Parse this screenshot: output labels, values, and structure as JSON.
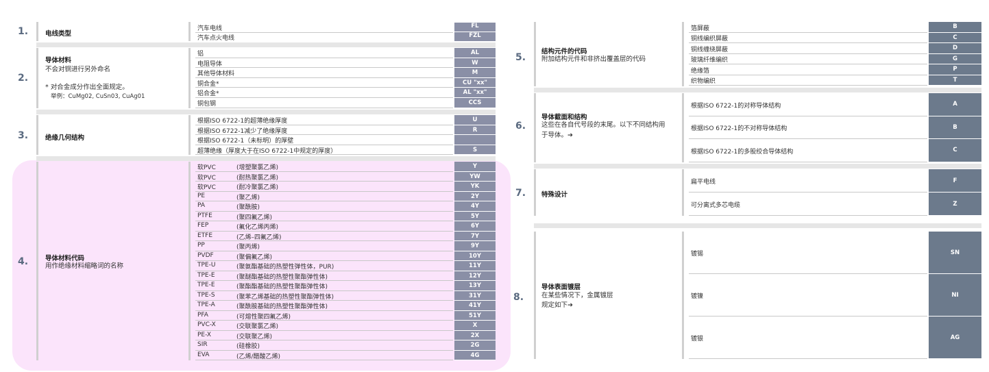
{
  "left": {
    "s1": {
      "num": "1.",
      "title": "电线类型",
      "rows": [
        {
          "label": "汽车电线",
          "code": "FL"
        },
        {
          "label": "汽车点火电线",
          "code": "FZL"
        }
      ]
    },
    "s2": {
      "num": "2.",
      "title": "导体材料",
      "sub": "不会对铜进行另外命名",
      "note1": "* 对合金成分作出全面规定。",
      "note2": "举例：CuMg02, CuSn03, CuAg01",
      "rows": [
        {
          "label": "铝",
          "code": "AL"
        },
        {
          "label": "电阻导体",
          "code": "W"
        },
        {
          "label": "其他导体材料",
          "code": "M"
        },
        {
          "label": "铜合金*",
          "code": "CU \"xx\""
        },
        {
          "label": "铝合金*",
          "code": "AL \"xx\""
        },
        {
          "label": "铜包钢",
          "code": "CCS"
        }
      ]
    },
    "s3": {
      "num": "3.",
      "title": "绝缘几何结构",
      "rows": [
        {
          "label": "根据ISO 6722-1的超薄绝缘厚度",
          "code": "U"
        },
        {
          "label": "根据ISO 6722-1减少了绝缘厚度",
          "code": "R"
        },
        {
          "label": "根据ISO 6722-1（未标明）的厚壁",
          "code": ""
        },
        {
          "label": "超薄绝缘（厚度大于在ISO 6722-1中规定的厚度）",
          "code": "S"
        }
      ]
    },
    "s4": {
      "num": "4.",
      "title": "导体材料代码",
      "sub": "用作绝缘材料缩略词的名称",
      "rows": [
        {
          "abbr": "软PVC",
          "label": "(增塑聚氯乙烯)",
          "code": "Y"
        },
        {
          "abbr": "软PVC",
          "label": "(耐热聚氯乙烯)",
          "code": "YW"
        },
        {
          "abbr": "软PVC",
          "label": "(耐冷聚氯乙烯)",
          "code": "YK"
        },
        {
          "abbr": "PE",
          "label": "(聚乙烯)",
          "code": "2Y"
        },
        {
          "abbr": "PA",
          "label": "(聚酰胺)",
          "code": "4Y"
        },
        {
          "abbr": "PTFE",
          "label": "(聚四氟乙烯)",
          "code": "5Y"
        },
        {
          "abbr": "FEP",
          "label": "(氟化乙烯丙烯)",
          "code": "6Y"
        },
        {
          "abbr": "ETFE",
          "label": "(乙烯–四氟乙烯)",
          "code": "7Y"
        },
        {
          "abbr": "PP",
          "label": "(聚丙烯)",
          "code": "9Y"
        },
        {
          "abbr": "PVDF",
          "label": "(聚偏氟乙烯)",
          "code": "10Y"
        },
        {
          "abbr": "TPE-U",
          "label": "(聚氨酯基础的热塑性弹性体，PUR)",
          "code": "11Y"
        },
        {
          "abbr": "TPE-E",
          "label": "(聚醚酯基础的热塑性聚酯弹性体)",
          "code": "12Y"
        },
        {
          "abbr": "TPE-E",
          "label": "(聚酯酯基础的热塑性聚酯弹性体)",
          "code": "13Y"
        },
        {
          "abbr": "TPE-S",
          "label": "(聚苯乙烯基础的热塑性聚酯弹性体)",
          "code": "31Y"
        },
        {
          "abbr": "TPE-A",
          "label": "(聚酰胺基础的热塑性聚酯弹性体)",
          "code": "41Y"
        },
        {
          "abbr": "PFA",
          "label": "(可熔性聚四氟乙烯)",
          "code": "51Y"
        },
        {
          "abbr": "PVC-X",
          "label": "(交联聚氯乙烯)",
          "code": "X"
        },
        {
          "abbr": "PE-X",
          "label": "(交联聚乙烯)",
          "code": "2X"
        },
        {
          "abbr": "SIR",
          "label": "(硅橡胶)",
          "code": "2G"
        },
        {
          "abbr": "EVA",
          "label": "(乙烯/醋酸乙烯)",
          "code": "4G"
        }
      ]
    }
  },
  "right": {
    "s5": {
      "num": "5.",
      "title": "结构元件的代码",
      "sub": "附加结构元件和非挤出覆盖层的代码",
      "rows": [
        {
          "label": "箔屏蔽",
          "code": "B"
        },
        {
          "label": "铜线编织屏蔽",
          "code": "C"
        },
        {
          "label": "铜线缠绕屏蔽",
          "code": "D"
        },
        {
          "label": "玻璃纤维编织",
          "code": "G"
        },
        {
          "label": "绝缘箔",
          "code": "P"
        },
        {
          "label": "织物编织",
          "code": "T"
        }
      ]
    },
    "s6": {
      "num": "6.",
      "title": "导体截面和结构",
      "sub1": "这些在各自代号段的末尾。以下不同结构用",
      "sub2": "于导体。➔",
      "rows": [
        {
          "label": "根据ISO 6722-1的对称导体结构",
          "code": "A"
        },
        {
          "label": "根据ISO 6722-1的不对称导体结构",
          "code": "B"
        },
        {
          "label": "根据ISO 6722-1的多股绞合导体结构",
          "code": "C"
        }
      ]
    },
    "s7": {
      "num": "7.",
      "title": "特殊设计",
      "rows": [
        {
          "label": "扁平电线",
          "code": "F"
        },
        {
          "label": "可分离式多芯电缆",
          "code": "Z"
        }
      ]
    },
    "s8": {
      "num": "8.",
      "title": "导体表面镀层",
      "sub1": "在某些情况下，金属镀层",
      "sub2": "规定如下➔",
      "rows": [
        {
          "label": "镀锡",
          "code": "SN"
        },
        {
          "label": "镀镍",
          "code": "NI"
        },
        {
          "label": "镀银",
          "code": "AG"
        }
      ]
    }
  }
}
